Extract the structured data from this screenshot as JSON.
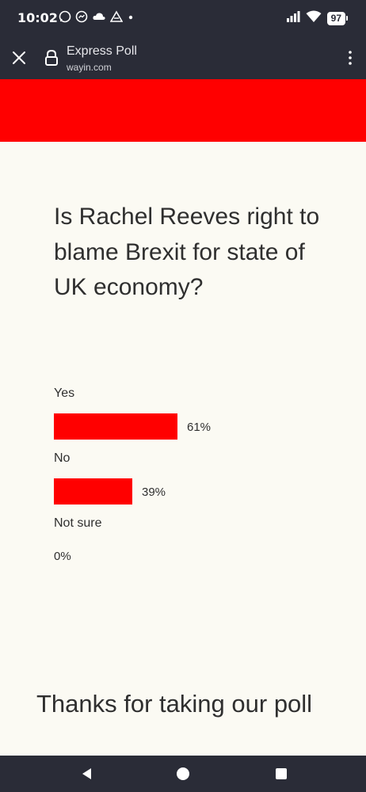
{
  "status_bar": {
    "time": "10:02",
    "battery": "97"
  },
  "browser": {
    "title": "Express Poll",
    "url": "wayin.com"
  },
  "poll": {
    "question": "Is Rachel Reeves right to blame Brexit for state of UK economy?",
    "accent_color": "#ff0000",
    "options": [
      {
        "label": "Yes",
        "percent_text": "61%",
        "fraction": 0.61
      },
      {
        "label": "No",
        "percent_text": "39%",
        "fraction": 0.39
      },
      {
        "label": "Not sure",
        "percent_text": "0%",
        "fraction": 0
      }
    ]
  },
  "footer": {
    "thanks": "Thanks for taking our poll"
  }
}
